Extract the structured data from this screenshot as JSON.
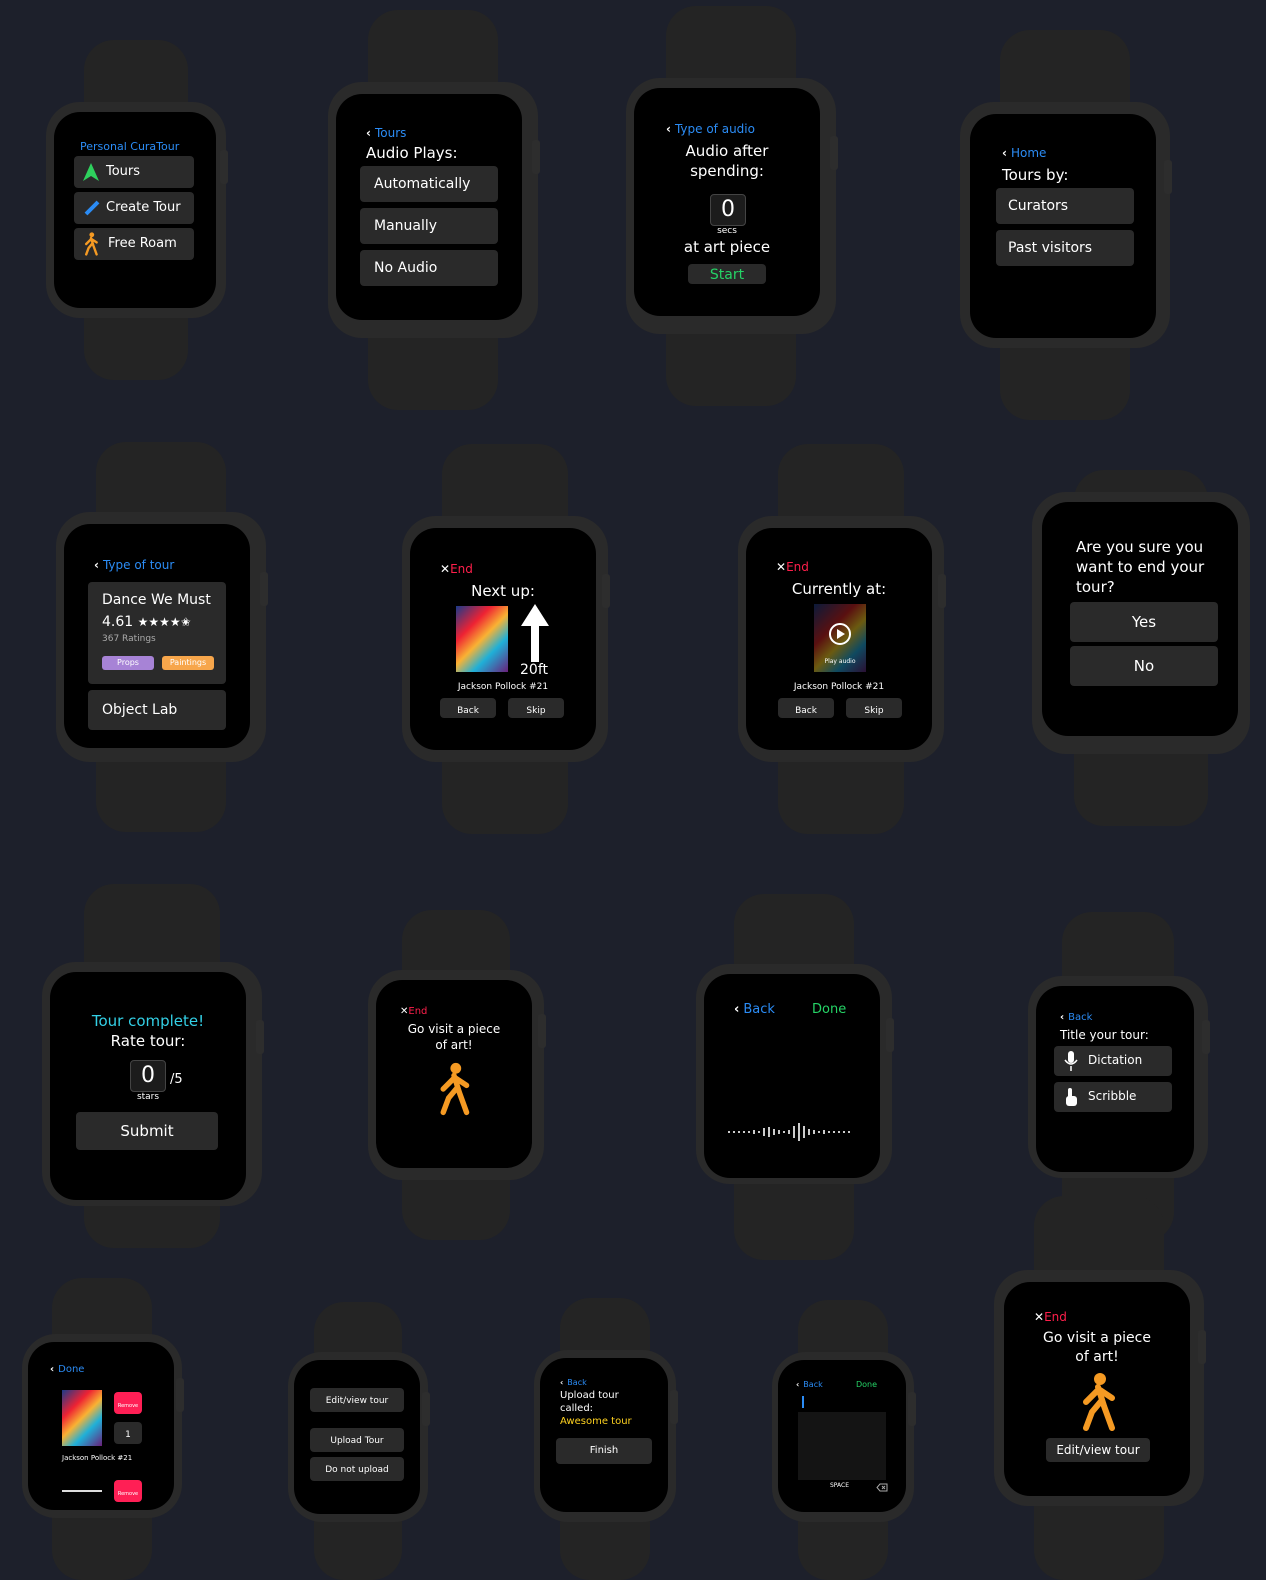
{
  "w1": {
    "title": "Personal CuraTour",
    "items": [
      "Tours",
      "Create Tour",
      "Free Roam"
    ]
  },
  "w2": {
    "back": "Tours",
    "heading": "Audio Plays:",
    "options": [
      "Automatically",
      "Manually",
      "No Audio"
    ]
  },
  "w3": {
    "back": "Type of audio",
    "line1": "Audio after",
    "line2": "spending:",
    "value": "0",
    "unit": "secs",
    "line3": "at art piece",
    "start": "Start"
  },
  "w4": {
    "back": "Home",
    "heading": "Tours by:",
    "options": [
      "Curators",
      "Past visitors"
    ]
  },
  "w5": {
    "back": "Type of tour",
    "tour_name": "Dance We Must",
    "rating": "4.61",
    "stars": "★★★★✬",
    "ratings_count": "367 Ratings",
    "tags": [
      "Props",
      "Paintings"
    ],
    "next_tour": "Object Lab"
  },
  "w6": {
    "end": "End",
    "heading": "Next up:",
    "distance": "20ft",
    "art": "Jackson Pollock #21",
    "back": "Back",
    "skip": "Skip"
  },
  "w7": {
    "end": "End",
    "heading": "Currently at:",
    "play": "Play audio",
    "art": "Jackson Pollock #21",
    "back": "Back",
    "skip": "Skip"
  },
  "w8": {
    "question": [
      "Are you sure you",
      "want to end your",
      "tour?"
    ],
    "yes": "Yes",
    "no": "No"
  },
  "w9": {
    "line1": "Tour complete!",
    "line2": "Rate tour:",
    "value": "0",
    "unit": "stars",
    "of": "/5",
    "submit": "Submit"
  },
  "w10": {
    "end": "End",
    "line1": "Go visit a piece",
    "line2": "of art!"
  },
  "w11": {
    "back": "Back",
    "done": "Done"
  },
  "w12": {
    "back": "Back",
    "heading": "Title your tour:",
    "options": [
      "Dictation",
      "Scribble"
    ]
  },
  "w13": {
    "back": "Done",
    "remove": "Remove",
    "count": "1",
    "art": "Jackson Pollock #21"
  },
  "w14": {
    "options": [
      "Edit/view tour",
      "Upload Tour",
      "Do not upload"
    ]
  },
  "w15": {
    "back": "Back",
    "line1": "Upload tour",
    "line2": "called:",
    "name": "Awesome tour",
    "finish": "Finish"
  },
  "w16": {
    "back": "Back",
    "done": "Done",
    "space": "SPACE"
  },
  "w17": {
    "end": "End",
    "line1": "Go visit a piece",
    "line2": "of art!",
    "button": "Edit/view tour"
  },
  "colors": {
    "background": "#1d202b",
    "accent_blue": "#2b8cf5",
    "end_red": "#ff1f4b",
    "go_green": "#25d366",
    "walker_orange": "#f59a23",
    "remove_pink": "#ff1f55",
    "complete_cyan": "#33d0e6",
    "tour_name_yellow": "#ffd21f"
  }
}
